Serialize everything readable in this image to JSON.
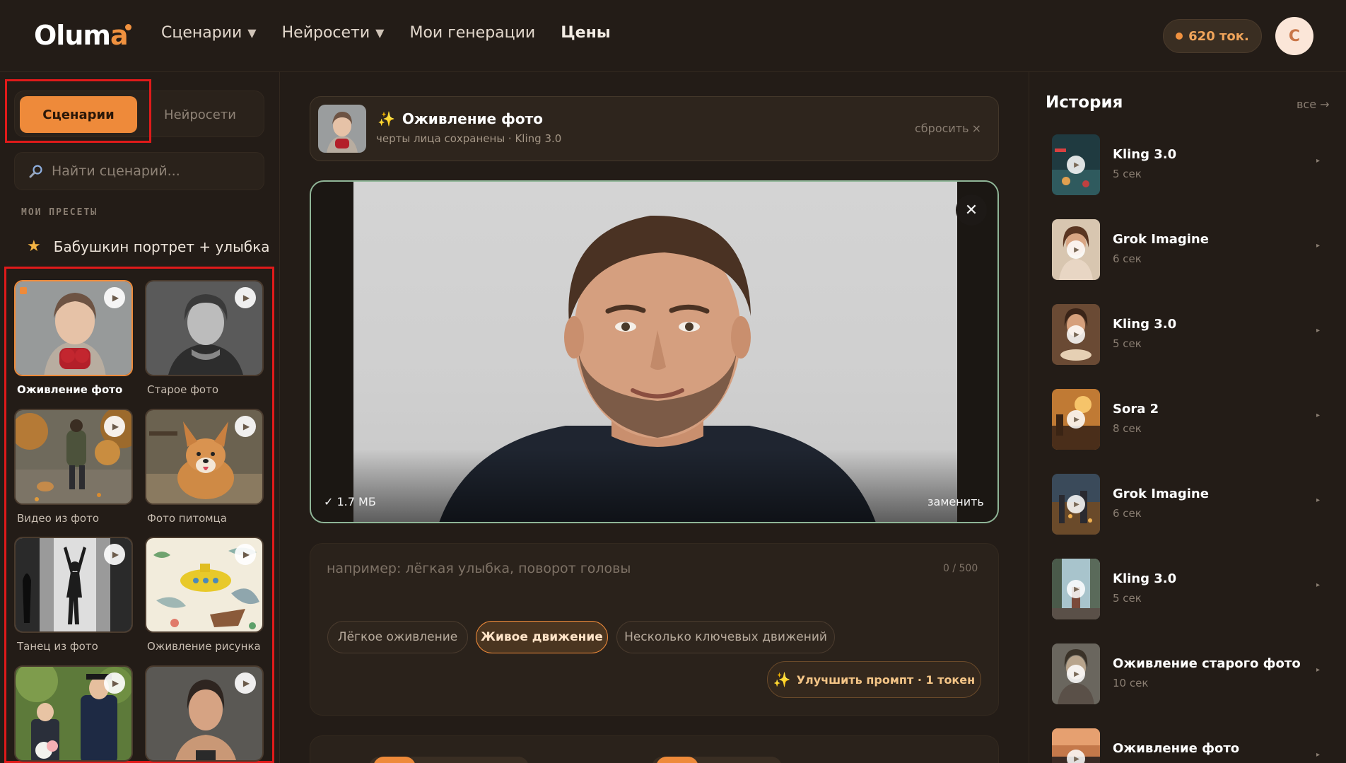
{
  "header": {
    "logo": "Oluma",
    "nav": [
      {
        "label": "Сценарии",
        "dropdown": true
      },
      {
        "label": "Нейросети",
        "dropdown": true
      },
      {
        "label": "Мои генерации",
        "dropdown": false
      },
      {
        "label": "Цены",
        "dropdown": false
      }
    ],
    "tokens": "620 ток.",
    "avatar_initial": "С"
  },
  "sidebar": {
    "tabs": [
      "Сценарии",
      "Нейросети"
    ],
    "active_tab": "Сценарии",
    "search_placeholder": "Найти сценарий...",
    "presets_title": "МОИ ПРЕСЕТЫ",
    "preset": "Бабушкин портрет + улыбка",
    "cards": [
      {
        "label": "Оживление фото",
        "selected": true
      },
      {
        "label": "Старое фото",
        "selected": false
      },
      {
        "label": "Видео из фото",
        "selected": false
      },
      {
        "label": "Фото питомца",
        "selected": false
      },
      {
        "label": "Танец из фото",
        "selected": false
      },
      {
        "label": "Оживление рисунка",
        "selected": false
      },
      {
        "label": "",
        "selected": false
      },
      {
        "label": "",
        "selected": false
      }
    ]
  },
  "scenario": {
    "title": "Оживление фото",
    "subtitle": "черты лица сохранены · Kling 3.0",
    "reset": "сбросить"
  },
  "upload": {
    "filesize": "✓ 1.7 МБ",
    "replace": "заменить"
  },
  "prompt": {
    "placeholder": "например: лёгкая улыбка, поворот головы",
    "counter": "0 / 500",
    "chips": [
      "Лёгкое оживление",
      "Живое движение",
      "Несколько ключевых движений"
    ],
    "active_chip": "Живое движение",
    "improve": "Улучшить промпт · 1 токен"
  },
  "history": {
    "title": "История",
    "all": "все →",
    "items": [
      {
        "name": "Kling 3.0",
        "duration": "5 сек"
      },
      {
        "name": "Grok Imagine",
        "duration": "6 сек"
      },
      {
        "name": "Kling 3.0",
        "duration": "5 сек"
      },
      {
        "name": "Sora 2",
        "duration": "8 сек"
      },
      {
        "name": "Grok Imagine",
        "duration": "6 сек"
      },
      {
        "name": "Kling 3.0",
        "duration": "5 сек"
      },
      {
        "name": "Оживление старого фото",
        "duration": "10 сек"
      },
      {
        "name": "Оживление фото",
        "duration": ""
      }
    ]
  },
  "colors": {
    "accent": "#ee8a3a",
    "background": "#231c17",
    "highlight": "#e01a1a",
    "upload_border": "#8fb597"
  }
}
